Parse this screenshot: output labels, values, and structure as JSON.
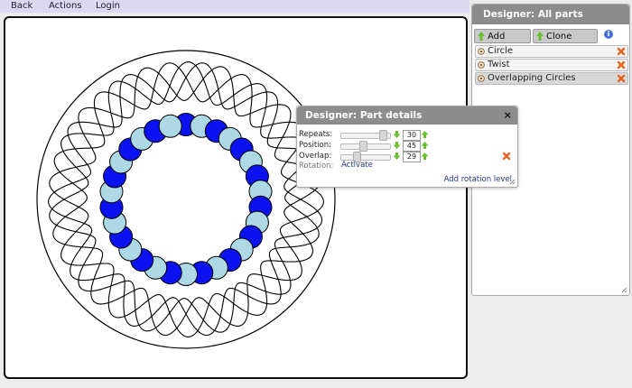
{
  "menu": {
    "back": "Back",
    "actions": "Actions",
    "login": "Login"
  },
  "parts_panel": {
    "title": "Designer: All parts",
    "add_shape": "Add shape",
    "clone_shape": "Clone shape",
    "parts": [
      "Circle",
      "Twist",
      "Overlapping Circles"
    ],
    "selected_part": "Overlapping Circles"
  },
  "details": {
    "title": "Designer: Part details",
    "close": "×",
    "repeats": {
      "label": "Repeats:",
      "value": "30",
      "fraction": 0.94
    },
    "position": {
      "label": "Position:",
      "value": "45",
      "fraction": 0.45
    },
    "overlap": {
      "label": "Overlap:",
      "value": "29",
      "fraction": 0.29
    },
    "rotation_label": "Rotation:",
    "activate": "Activate",
    "add_rotation": "Add rotation level"
  },
  "design": {
    "circle_count": 30,
    "colors": {
      "dark": "#0a12f0",
      "light": "#add8e6",
      "stroke": "#000000",
      "canvas": "#ffffff",
      "accent_green": "#6abf2e",
      "delete_orange": "#e8611f"
    }
  }
}
